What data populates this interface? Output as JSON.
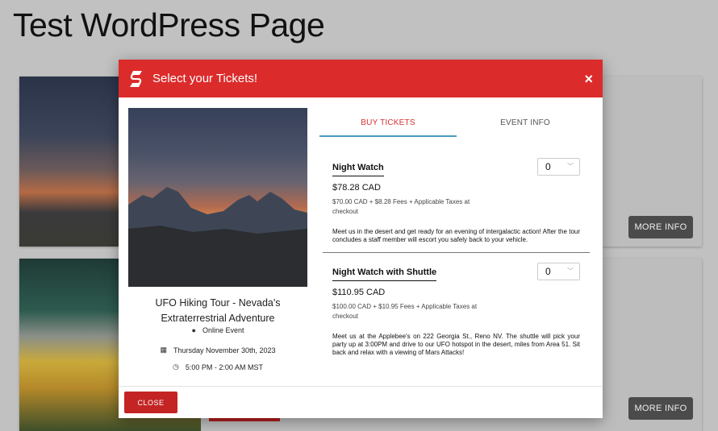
{
  "page": {
    "title": "Test WordPress Page"
  },
  "background": {
    "more_info_label": "MORE INFO"
  },
  "modal": {
    "title": "Select your Tickets!",
    "close_icon": "×",
    "event": {
      "name": "UFO Hiking Tour - Nevada's Extraterrestrial Adventure",
      "location": "Online Event",
      "date": "Thursday November 30th, 2023",
      "time": "5:00 PM - 2:00 AM MST"
    },
    "tabs": [
      {
        "label": "BUY TICKETS",
        "active": true
      },
      {
        "label": "EVENT INFO",
        "active": false
      }
    ],
    "tickets": [
      {
        "name": "Night Watch",
        "price": "$78.28 CAD",
        "fees": "$70.00 CAD + $8.28 Fees + Applicable Taxes at checkout",
        "description": "Meet us in the desert and get ready for an evening of intergalactic action! After the tour concludes a staff member will escort you safely back to your vehicle.",
        "quantity": "0"
      },
      {
        "name": "Night Watch with Shuttle",
        "price": "$110.95 CAD",
        "fees": "$100.00 CAD + $10.95 Fees + Applicable Taxes at checkout",
        "description": "Meet us at the Applebee's on 222 Georgia St., Reno NV. The shuttle will pick your party up at 3:00PM and drive to our UFO hotspot in the desert, miles from Area 51. Sit back and relax with a viewing of Mars Attacks!",
        "quantity": "0"
      }
    ],
    "footer": {
      "close_label": "CLOSE"
    }
  },
  "colors": {
    "accent": "#dc2b2b",
    "tab_underline": "#4a9bbf",
    "close_button": "#c42424"
  },
  "icons": {
    "logo": "brand-logo-icon",
    "location": "globe-icon",
    "date": "calendar-icon",
    "time": "clock-icon",
    "select": "chevron-down-icon"
  }
}
